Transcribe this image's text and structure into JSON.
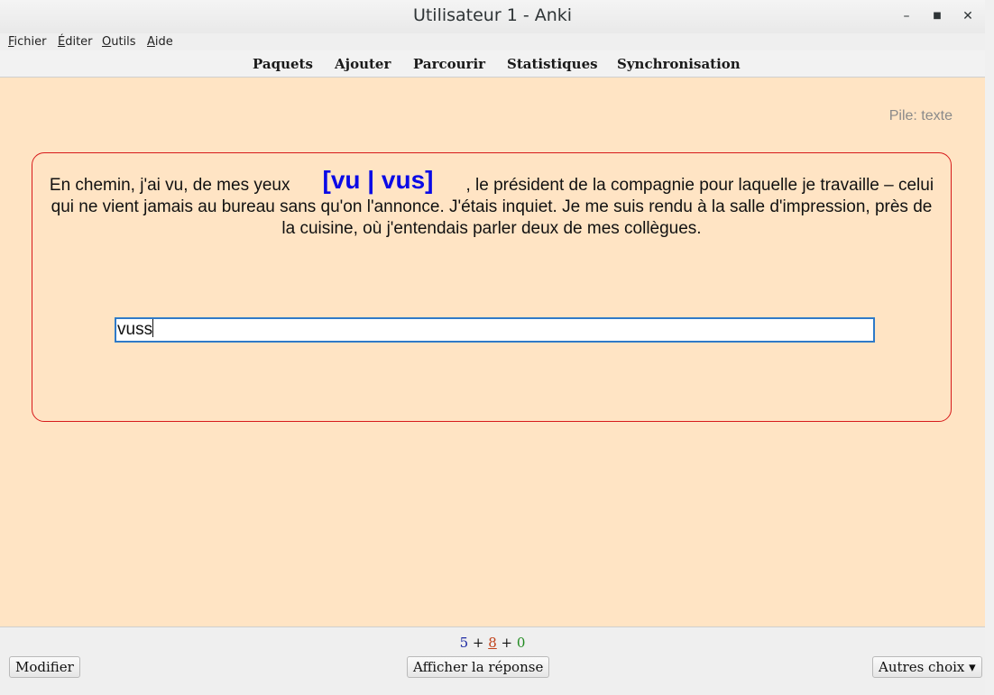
{
  "window": {
    "title": "Utilisateur 1 - Anki"
  },
  "window_controls": {
    "minimize": "–",
    "maximize": "■",
    "close": "✕"
  },
  "menu": {
    "fichier_first": "F",
    "fichier_rest": "ichier",
    "editer_first": "É",
    "editer_rest": "diter",
    "outils_first": "O",
    "outils_rest": "utils",
    "aide_first": "A",
    "aide_rest": "ide"
  },
  "toolbar": {
    "decks": "Paquets",
    "add": "Ajouter",
    "browse": "Parcourir",
    "stats": "Statistiques",
    "sync": "Synchronisation"
  },
  "review": {
    "deck_label": "Pile: texte",
    "text_before": "En chemin, j'ai vu, de mes yeux",
    "cloze": "[vu | vus]",
    "text_after": ", le président de la compagnie pour laquelle je travaille – celui qui ne vient jamais au bureau sans qu'on l'annonce. J'étais inquiet. Je me suis rendu à la salle d'impression, près de la cuisine, où j'entendais parler deux de mes collègues.",
    "answer_value": "vuss"
  },
  "counts": {
    "new": "5",
    "plus1": " + ",
    "learn": "8",
    "plus2": " + ",
    "review": "0"
  },
  "bottom": {
    "edit_label": "Modifier",
    "show_answer_label": "Afficher la réponse",
    "more_label": "Autres choix ▾"
  },
  "colors": {
    "background": "#ffe4c4",
    "card_border": "#d71a1a",
    "cloze": "#0a0ae6",
    "input_focus": "#2f7ac8"
  }
}
